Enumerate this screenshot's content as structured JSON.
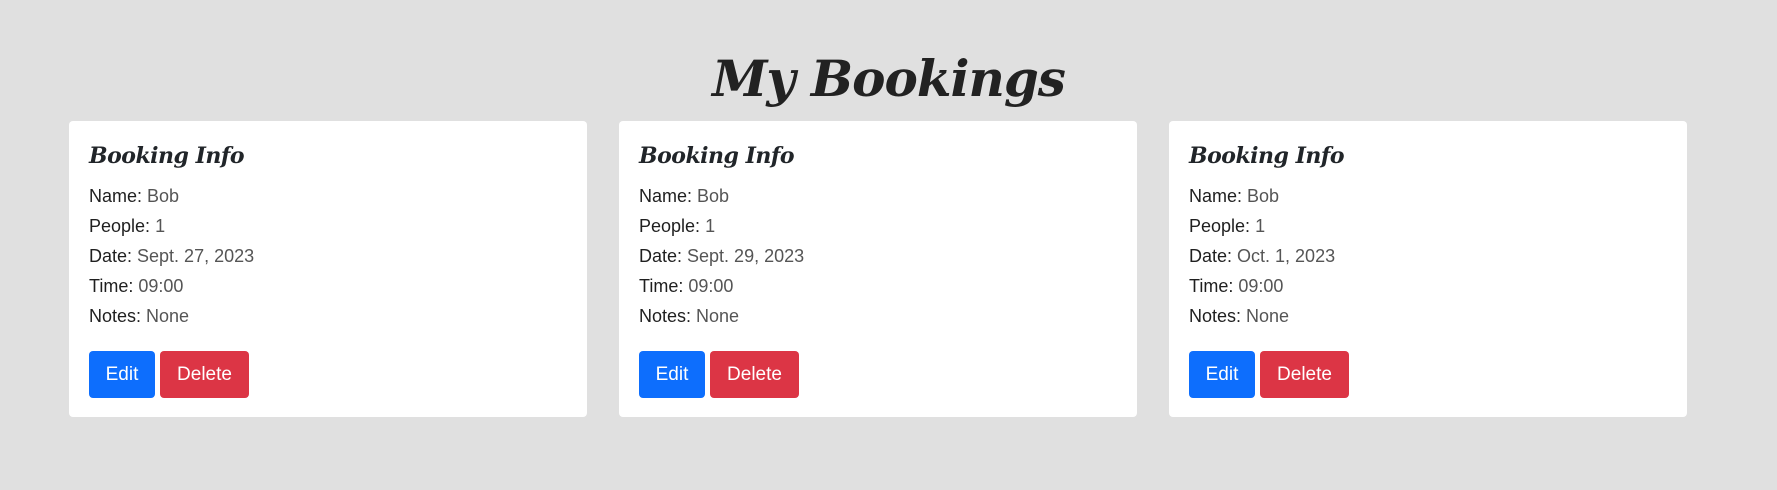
{
  "page": {
    "title": "My Bookings"
  },
  "labels": {
    "name": "Name:",
    "people": "People:",
    "date": "Date:",
    "time": "Time:",
    "notes": "Notes:"
  },
  "bookings": [
    {
      "card_title": "Booking Info",
      "name": "Bob",
      "people": "1",
      "date": "Sept. 27, 2023",
      "time": "09:00",
      "notes": "None",
      "edit_label": "Edit",
      "delete_label": "Delete"
    },
    {
      "card_title": "Booking Info",
      "name": "Bob",
      "people": "1",
      "date": "Sept. 29, 2023",
      "time": "09:00",
      "notes": "None",
      "edit_label": "Edit",
      "delete_label": "Delete"
    },
    {
      "card_title": "Booking Info",
      "name": "Bob",
      "people": "1",
      "date": "Oct. 1, 2023",
      "time": "09:00",
      "notes": "None",
      "edit_label": "Edit",
      "delete_label": "Delete"
    }
  ],
  "colors": {
    "background": "#e0e0e0",
    "edit_button": "#0d6efd",
    "delete_button": "#dc3545"
  }
}
